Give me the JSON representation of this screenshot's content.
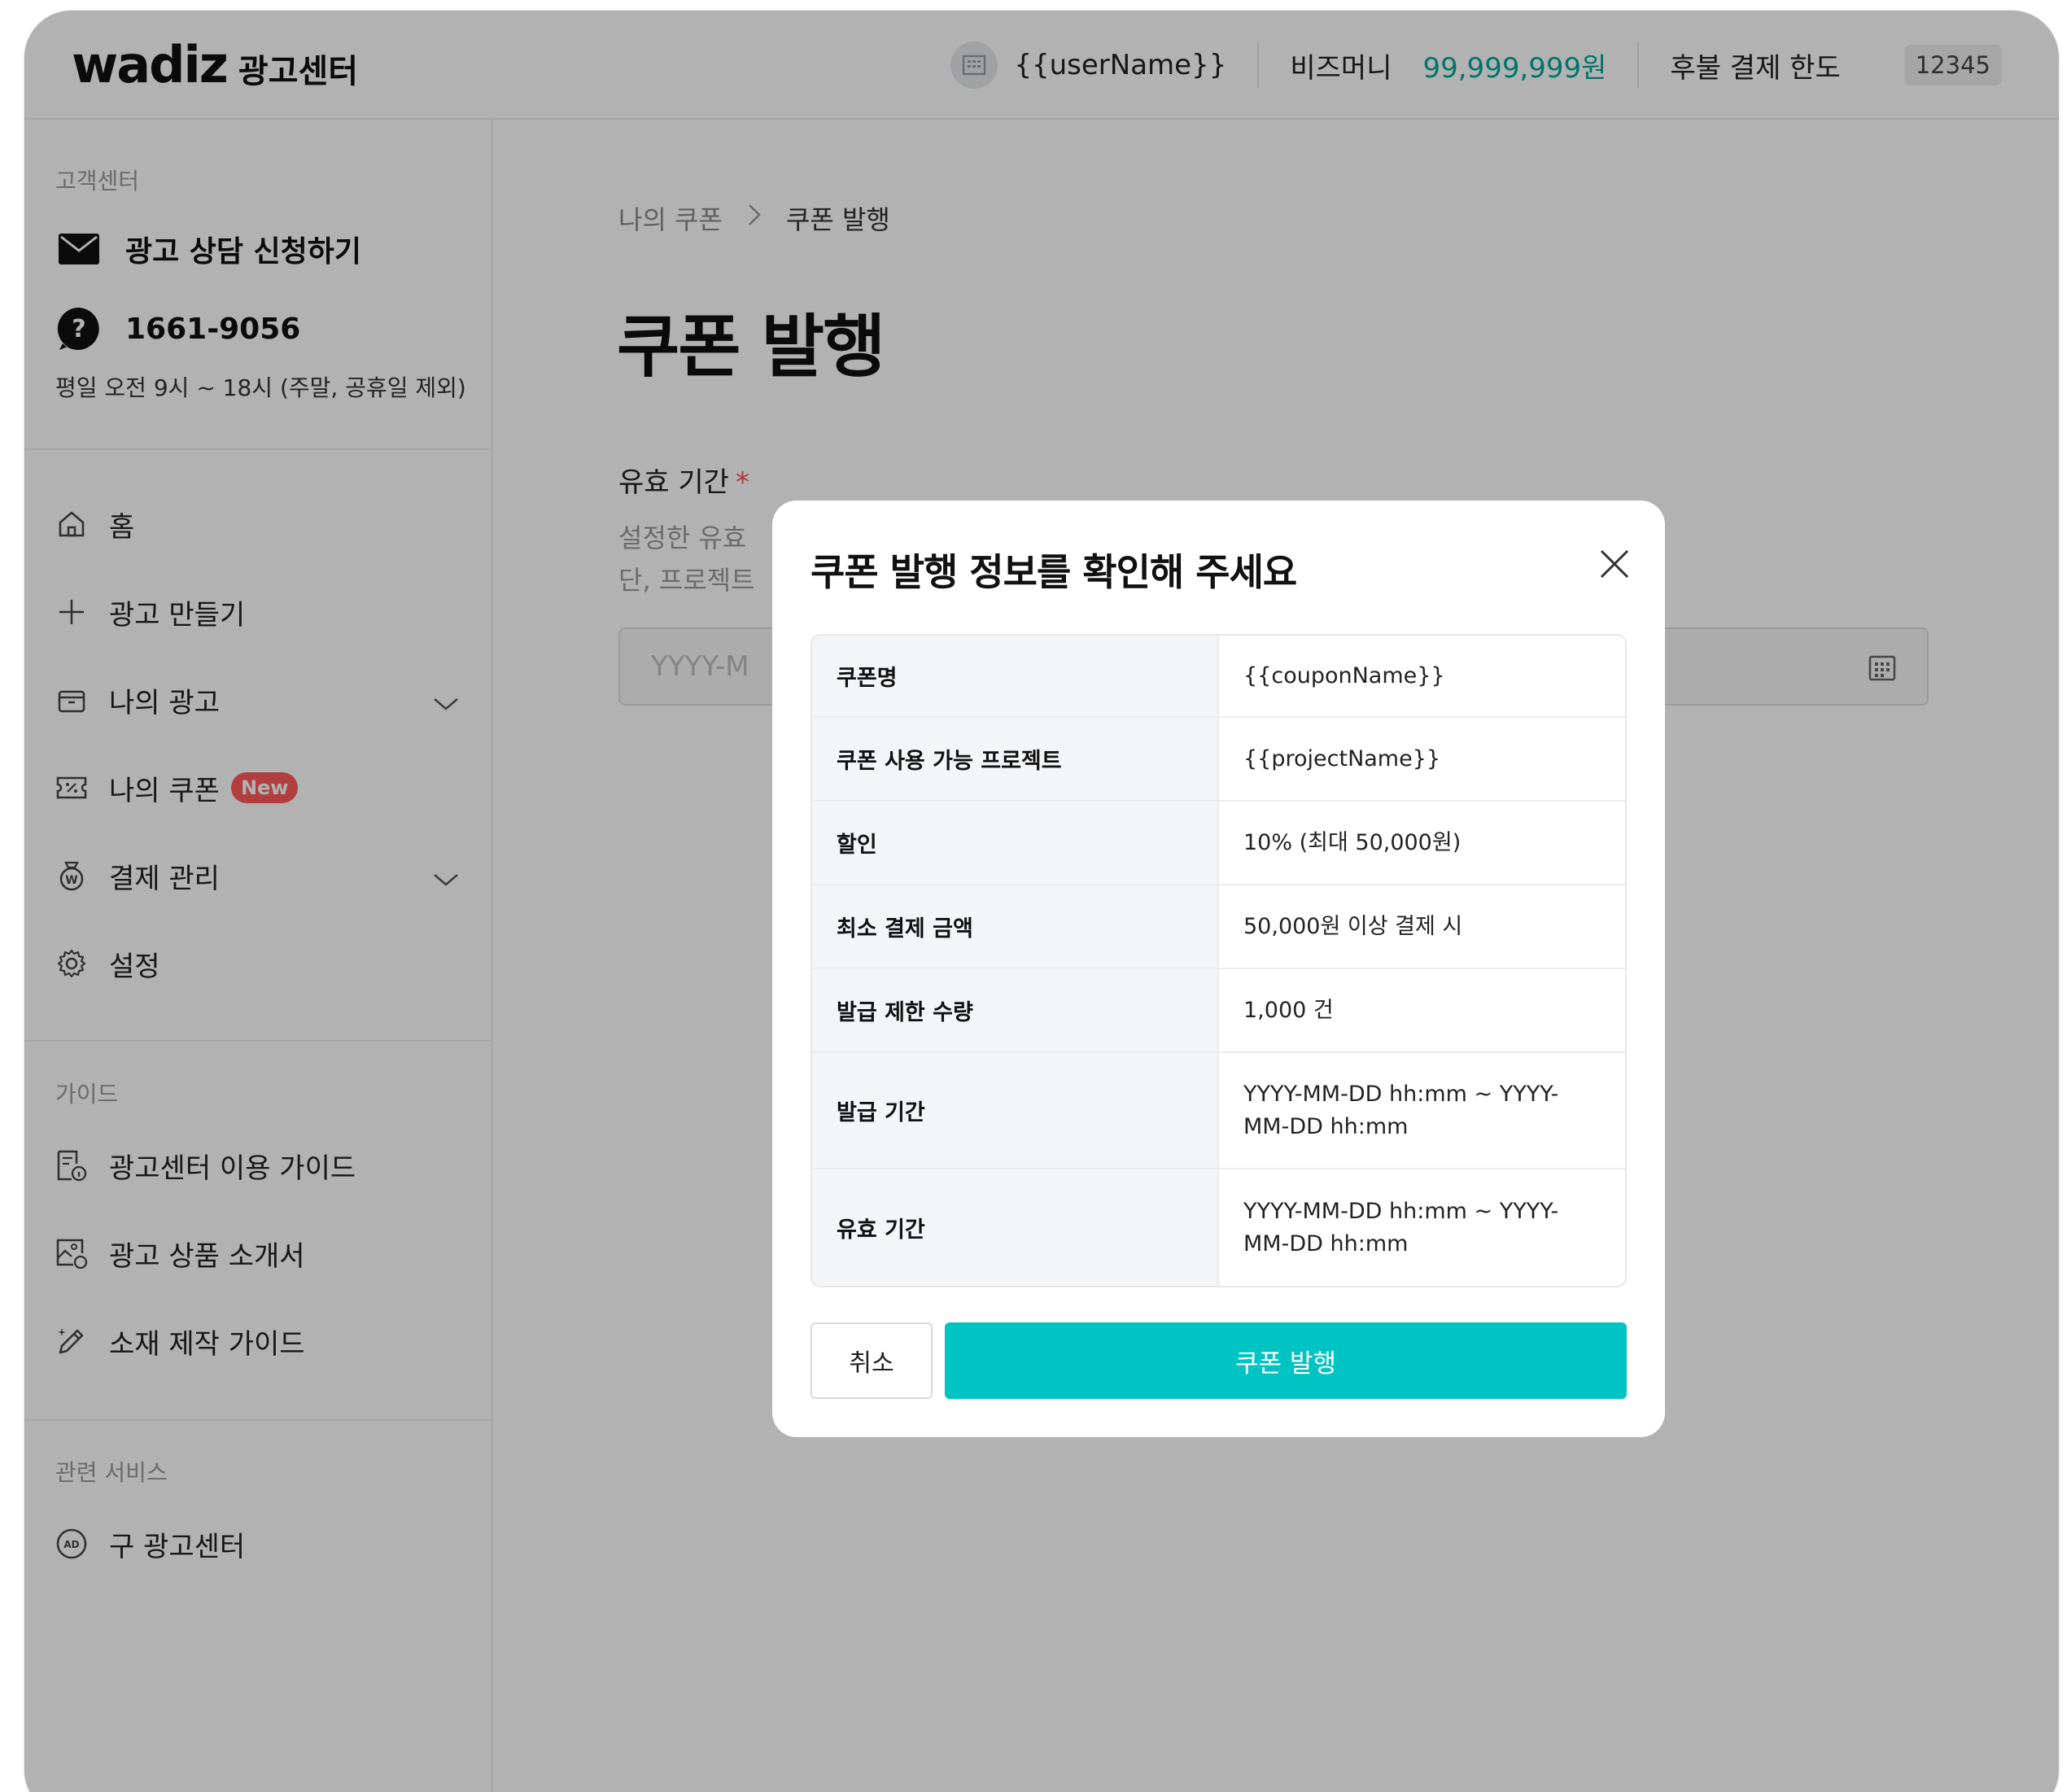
{
  "header": {
    "logo_mark": "wadiz",
    "logo_sub": "광고센터",
    "user_name": "{{userName}}",
    "biz_money_label": "비즈머니",
    "biz_money_value": "99,999,999원",
    "postpay_label": "후불 결제 한도",
    "postpay_badge": "12345"
  },
  "sidebar": {
    "support_label": "고객센터",
    "consult": "광고 상담 신청하기",
    "phone": "1661-9056",
    "hours": "평일 오전 9시 ~ 18시 (주말, 공휴일 제외)",
    "nav": [
      {
        "label": "홈"
      },
      {
        "label": "광고 만들기"
      },
      {
        "label": "나의 광고"
      },
      {
        "label": "나의 쿠폰",
        "badge": "New"
      },
      {
        "label": "결제 관리"
      },
      {
        "label": "설정"
      }
    ],
    "guide_label": "가이드",
    "guides": [
      {
        "label": "광고센터 이용 가이드"
      },
      {
        "label": "광고 상품 소개서"
      },
      {
        "label": "소재 제작 가이드"
      }
    ],
    "related_label": "관련 서비스",
    "related": [
      {
        "label": "구 광고센터"
      }
    ]
  },
  "main": {
    "breadcrumb": [
      "나의 쿠폰",
      "쿠폰 발행"
    ],
    "title": "쿠폰 발행",
    "field_label": "유효 기간",
    "field_desc_1": "설정한 유효",
    "field_desc_2": "단, 프로젝트",
    "date_placeholder": "YYYY-M"
  },
  "modal": {
    "title": "쿠폰 발행 정보를 확인해 주세요",
    "rows": [
      {
        "key": "쿠폰명",
        "value": "{{couponName}}"
      },
      {
        "key": "쿠폰 사용 가능 프로젝트",
        "value": "{{projectName}}"
      },
      {
        "key": "할인",
        "value": "10% (최대 50,000원)"
      },
      {
        "key": "최소 결제 금액",
        "value": "50,000원 이상 결제 시"
      },
      {
        "key": "발급 제한 수량",
        "value": "1,000 건"
      },
      {
        "key": "발급 기간",
        "value": "YYYY-MM-DD hh:mm ~ YYYY-MM-DD hh:mm"
      },
      {
        "key": "유효 기간",
        "value": "YYYY-MM-DD hh:mm ~ YYYY-MM-DD hh:mm"
      }
    ],
    "cancel_label": "취소",
    "confirm_label": "쿠폰 발행"
  },
  "colors": {
    "accent": "#00c4c4",
    "money": "#00a69b",
    "new_badge": "#ff5a5a",
    "required": "#ff4d4d"
  }
}
